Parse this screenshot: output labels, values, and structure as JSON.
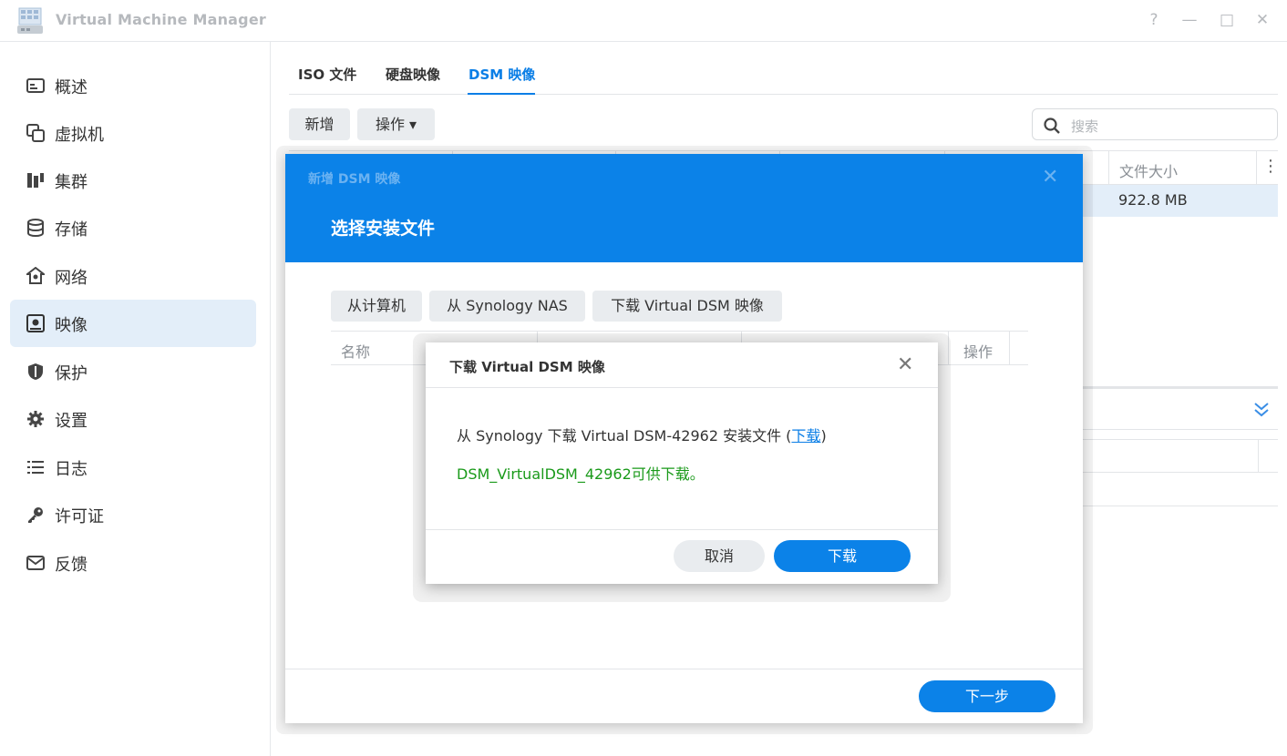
{
  "app": {
    "title": "Virtual Machine Manager"
  },
  "window_controls": {
    "help": "?",
    "minimize": "—",
    "maximize": "□",
    "close": "✕"
  },
  "sidebar": {
    "items": [
      {
        "label": "概述",
        "icon": "overview-icon"
      },
      {
        "label": "虚拟机",
        "icon": "vm-icon"
      },
      {
        "label": "集群",
        "icon": "cluster-icon"
      },
      {
        "label": "存储",
        "icon": "storage-icon"
      },
      {
        "label": "网络",
        "icon": "network-icon"
      },
      {
        "label": "映像",
        "icon": "image-icon",
        "active": true
      },
      {
        "label": "保护",
        "icon": "shield-icon"
      },
      {
        "label": "设置",
        "icon": "gear-icon"
      },
      {
        "label": "日志",
        "icon": "log-icon"
      },
      {
        "label": "许可证",
        "icon": "key-icon"
      },
      {
        "label": "反馈",
        "icon": "mail-icon"
      }
    ]
  },
  "tabs": [
    {
      "label": "ISO 文件"
    },
    {
      "label": "硬盘映像"
    },
    {
      "label": "DSM 映像",
      "active": true
    }
  ],
  "toolbar": {
    "add_label": "新增",
    "action_label": "操作 ▾",
    "search_placeholder": "搜索"
  },
  "bg_table": {
    "col_filesize": "文件大小",
    "row_filesize": "922.8 MB",
    "more": "⋮",
    "expand": "︾"
  },
  "dialog1": {
    "small_title": "新增 DSM 映像",
    "close": "✕",
    "title": "选择安装文件",
    "buttons": {
      "from_computer": "从计算机",
      "from_nas": "从 Synology NAS",
      "download_vdsm": "下载 Virtual DSM 映像"
    },
    "table_headers": {
      "name": "名称",
      "action": "操作"
    },
    "next_label": "下一步"
  },
  "dialog2": {
    "title": "下载 Virtual DSM 映像",
    "close": "✕",
    "line_prefix": "从 Synology 下载 Virtual DSM-42962 安装文件 (",
    "link_text": "下载",
    "line_suffix": ")",
    "status": "DSM_VirtualDSM_42962可供下载。",
    "cancel_label": "取消",
    "download_label": "下载"
  },
  "colors": {
    "accent": "#0b82e8",
    "success": "#1a9a1a",
    "active_bg": "#e3eef9"
  }
}
